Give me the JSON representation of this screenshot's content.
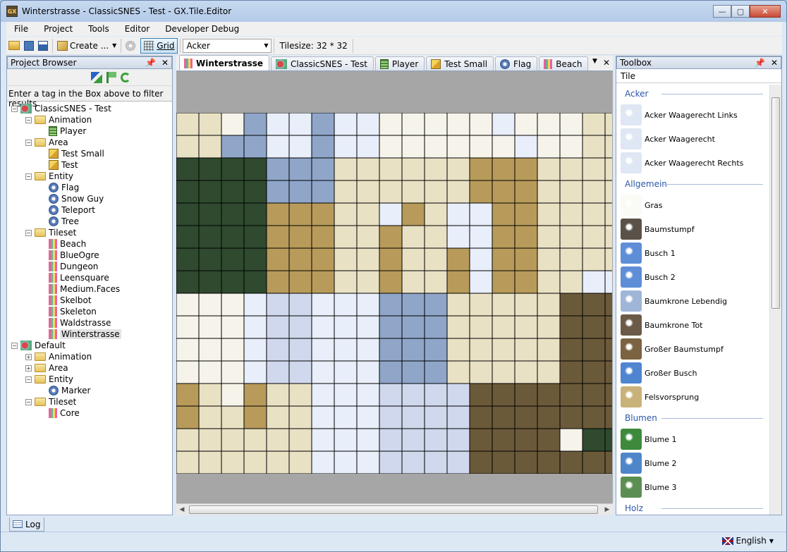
{
  "window": {
    "title": "Winterstrasse - ClassicSNES - Test - GX.Tile.Editor",
    "app_icon_text": "GX",
    "minimize": "—",
    "maximize": "▢",
    "close": "✕"
  },
  "menu": [
    "File",
    "Project",
    "Tools",
    "Editor",
    "Developer Debug"
  ],
  "toolbar": {
    "create_label": "Create ...",
    "grid_label": "Grid",
    "tile_combo": "Acker",
    "tilesize_label": "Tilesize: 32 * 32"
  },
  "project_browser": {
    "title": "Project Browser",
    "filter_hint": "Enter a tag in the Box above to filter results",
    "tree": [
      {
        "label": "ClassicSNES - Test",
        "icon": "project-icon",
        "level": 0,
        "toggle": "−"
      },
      {
        "label": "Animation",
        "icon": "folder-icon",
        "level": 1,
        "toggle": "−"
      },
      {
        "label": "Player",
        "icon": "animation-icon",
        "level": 2
      },
      {
        "label": "Area",
        "icon": "folder-icon",
        "level": 1,
        "toggle": "−"
      },
      {
        "label": "Test Small",
        "icon": "area-icon",
        "level": 2
      },
      {
        "label": "Test",
        "icon": "area-icon",
        "level": 2
      },
      {
        "label": "Entity",
        "icon": "folder-icon",
        "level": 1,
        "toggle": "−"
      },
      {
        "label": "Flag",
        "icon": "entity-icon",
        "level": 2
      },
      {
        "label": "Snow Guy",
        "icon": "entity-icon",
        "level": 2
      },
      {
        "label": "Teleport",
        "icon": "entity-icon",
        "level": 2
      },
      {
        "label": "Tree",
        "icon": "entity-icon",
        "level": 2
      },
      {
        "label": "Tileset",
        "icon": "folder-icon",
        "level": 1,
        "toggle": "−"
      },
      {
        "label": "Beach",
        "icon": "tileset-icon",
        "level": 2
      },
      {
        "label": "BlueOgre",
        "icon": "tileset-icon",
        "level": 2
      },
      {
        "label": "Dungeon",
        "icon": "tileset-icon",
        "level": 2
      },
      {
        "label": "Leensquare",
        "icon": "tileset-icon",
        "level": 2
      },
      {
        "label": "Medium.Faces",
        "icon": "tileset-icon",
        "level": 2
      },
      {
        "label": "Skelbot",
        "icon": "tileset-icon",
        "level": 2
      },
      {
        "label": "Skeleton",
        "icon": "tileset-icon",
        "level": 2
      },
      {
        "label": "Waldstrasse",
        "icon": "tileset-icon",
        "level": 2
      },
      {
        "label": "Winterstrasse",
        "icon": "tileset-icon",
        "level": 2,
        "selected": true
      },
      {
        "label": "Default",
        "icon": "project-icon",
        "level": 0,
        "toggle": "−"
      },
      {
        "label": "Animation",
        "icon": "folder-icon",
        "level": 1,
        "toggle": "+"
      },
      {
        "label": "Area",
        "icon": "folder-icon",
        "level": 1,
        "toggle": "+"
      },
      {
        "label": "Entity",
        "icon": "folder-icon",
        "level": 1,
        "toggle": "−"
      },
      {
        "label": "Marker",
        "icon": "entity-icon",
        "level": 2
      },
      {
        "label": "Tileset",
        "icon": "folder-icon",
        "level": 1,
        "toggle": "−"
      },
      {
        "label": "Core",
        "icon": "tileset-icon",
        "level": 2
      }
    ]
  },
  "editor_tabs": [
    {
      "label": "Winterstrasse",
      "icon": "tileset-icon",
      "active": true
    },
    {
      "label": "ClassicSNES - Test",
      "icon": "project-icon"
    },
    {
      "label": "Player",
      "icon": "animation-icon"
    },
    {
      "label": "Test Small",
      "icon": "area-icon"
    },
    {
      "label": "Flag",
      "icon": "entity-icon"
    },
    {
      "label": "Beach",
      "icon": "tileset-icon"
    }
  ],
  "toolbox": {
    "title": "Toolbox",
    "tab": "Tile",
    "groups": [
      {
        "name": "Acker",
        "items": [
          {
            "label": "Acker Waagerecht Links",
            "color": "#dfe6f4"
          },
          {
            "label": "Acker Waagerecht",
            "color": "#dfe6f4"
          },
          {
            "label": "Acker Waagerecht Rechts",
            "color": "#dfe6f4"
          }
        ]
      },
      {
        "name": "Allgemein",
        "items": [
          {
            "label": "Gras",
            "color": "#fbfbf6"
          },
          {
            "label": "Baumstumpf",
            "color": "#5a5248"
          },
          {
            "label": "Busch 1",
            "color": "#5d8ed6"
          },
          {
            "label": "Busch 2",
            "color": "#5d8ed6"
          },
          {
            "label": "Baumkrone Lebendig",
            "color": "#9fb6d8"
          },
          {
            "label": "Baumkrone Tot",
            "color": "#6b5a48"
          },
          {
            "label": "Großer Baumstumpf",
            "color": "#7b6240"
          },
          {
            "label": "Großer Busch",
            "color": "#4f84d0"
          },
          {
            "label": "Felsvorsprung",
            "color": "#c9b27a"
          }
        ]
      },
      {
        "name": "Blumen",
        "items": [
          {
            "label": "Blume 1",
            "color": "#3d8a3d"
          },
          {
            "label": "Blume 2",
            "color": "#4f86c9"
          },
          {
            "label": "Blume 3",
            "color": "#5b8f52"
          }
        ]
      },
      {
        "name": "Holz",
        "items": []
      }
    ]
  },
  "log_tab": "Log",
  "status": {
    "language": "English"
  }
}
